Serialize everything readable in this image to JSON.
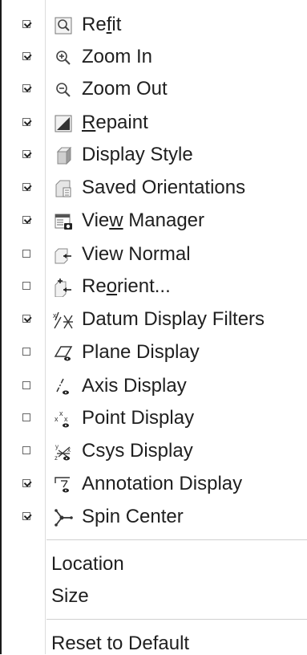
{
  "menu": {
    "items": [
      {
        "label_pre": "Re",
        "label_u": "f",
        "label_post": "it",
        "checked": true,
        "icon": "refit-icon"
      },
      {
        "label_pre": "Zoom In",
        "label_u": "",
        "label_post": "",
        "checked": true,
        "icon": "zoom-in-icon"
      },
      {
        "label_pre": "Zoom Out",
        "label_u": "",
        "label_post": "",
        "checked": true,
        "icon": "zoom-out-icon"
      },
      {
        "label_pre": "",
        "label_u": "R",
        "label_post": "epaint",
        "checked": true,
        "icon": "repaint-icon"
      },
      {
        "label_pre": "Display Style",
        "label_u": "",
        "label_post": "",
        "checked": true,
        "icon": "display-style-icon"
      },
      {
        "label_pre": "Saved Orientations",
        "label_u": "",
        "label_post": "",
        "checked": true,
        "icon": "saved-orientations-icon"
      },
      {
        "label_pre": "Vie",
        "label_u": "w",
        "label_post": " Manager",
        "checked": true,
        "icon": "view-manager-icon"
      },
      {
        "label_pre": "View Normal",
        "label_u": "",
        "label_post": "",
        "checked": false,
        "icon": "view-normal-icon"
      },
      {
        "label_pre": "Re",
        "label_u": "o",
        "label_post": "rient...",
        "checked": false,
        "icon": "reorient-icon"
      },
      {
        "label_pre": "Datum Display Filters",
        "label_u": "",
        "label_post": "",
        "checked": true,
        "icon": "datum-display-filters-icon"
      },
      {
        "label_pre": "Plane Display",
        "label_u": "",
        "label_post": "",
        "checked": false,
        "icon": "plane-display-icon"
      },
      {
        "label_pre": "Axis Display",
        "label_u": "",
        "label_post": "",
        "checked": false,
        "icon": "axis-display-icon"
      },
      {
        "label_pre": "Point Display",
        "label_u": "",
        "label_post": "",
        "checked": false,
        "icon": "point-display-icon"
      },
      {
        "label_pre": "Csys Display",
        "label_u": "",
        "label_post": "",
        "checked": false,
        "icon": "csys-display-icon"
      },
      {
        "label_pre": "Annotation Display",
        "label_u": "",
        "label_post": "",
        "checked": true,
        "icon": "annotation-display-icon"
      },
      {
        "label_pre": "Spin Center",
        "label_u": "",
        "label_post": "",
        "checked": true,
        "icon": "spin-center-icon"
      }
    ],
    "location_label": "Location",
    "size_label": "Size",
    "reset_label": "Reset to Default"
  }
}
